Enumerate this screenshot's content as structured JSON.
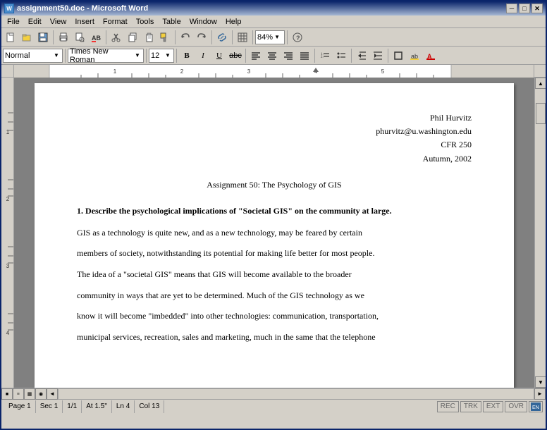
{
  "titleBar": {
    "title": "assignment50.doc - Microsoft Word",
    "icon": "W",
    "minimize": "─",
    "maximize": "□",
    "close": "✕"
  },
  "menuBar": {
    "items": [
      "File",
      "Edit",
      "View",
      "Insert",
      "Format",
      "Tools",
      "Table",
      "Window",
      "Help"
    ]
  },
  "toolbar1": {
    "buttons": [
      "📄",
      "📂",
      "💾",
      "🖨",
      "🔍",
      "✂",
      "📋",
      "📋",
      "↩",
      "↪",
      "🔡",
      "🔍",
      "📊",
      "📋",
      "📷",
      "📊",
      "📊",
      "📊",
      "📊",
      "📊",
      "📊",
      "📊"
    ],
    "zoom": "84%"
  },
  "toolbar2": {
    "style": "Normal",
    "font": "Times New Roman",
    "size": "12",
    "bold": "B",
    "italic": "I",
    "underline": "U",
    "strikethrough": "ab̶c"
  },
  "statusBar": {
    "page": "Page 1",
    "section": "Sec 1",
    "pageOf": "1/1",
    "at": "At 1.5\"",
    "ln": "Ln 4",
    "col": "Col 13",
    "rec": "REC",
    "trk": "TRK",
    "ext": "EXT",
    "ovr": "OVR"
  },
  "document": {
    "headerName": "Phil Hurvitz",
    "headerEmail": "phurvitz@u.washington.edu",
    "headerCourse": "CFR 250",
    "headerSemester": "Autumn, 2002",
    "title": "Assignment 50:  The Psychology of GIS",
    "q1": "1. Describe the psychological implications of \"Societal GIS\" on the community at large.",
    "p1": "GIS as a technology is quite new, and as a new technology, may be feared by certain",
    "p2": "members of society, notwithstanding its potential for making life better for most people.",
    "p3": "The idea of a \"societal GIS\" means that GIS will become available to the broader",
    "p4": "community in ways that are yet to be determined.  Much of the GIS technology as we",
    "p5": "know it will become \"imbedded\" into other technologies: communication, transportation,",
    "p6": "municipal services, recreation, sales and marketing, much in the same that the telephone"
  }
}
